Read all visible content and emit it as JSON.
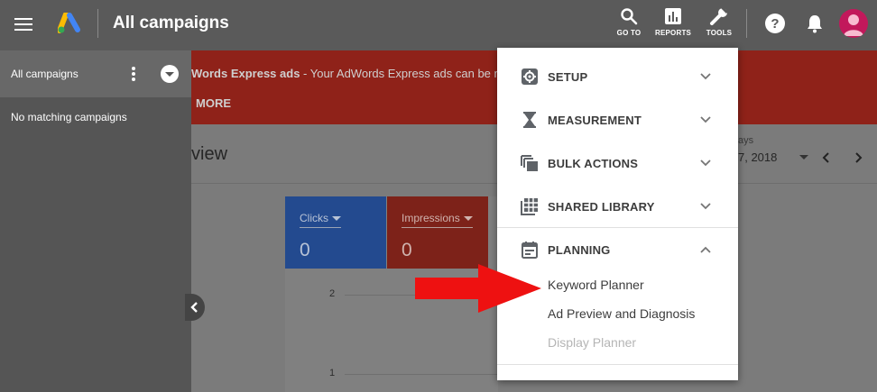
{
  "header": {
    "title": "All campaigns",
    "actions": [
      {
        "label": "GO TO",
        "icon": "search-icon"
      },
      {
        "label": "REPORTS",
        "icon": "bar-chart-icon"
      },
      {
        "label": "TOOLS",
        "icon": "wrench-icon"
      }
    ]
  },
  "sidebar": {
    "title": "All campaigns",
    "empty_text": "No matching campaigns"
  },
  "banner": {
    "text_bold": "Words Express ads",
    "text_rest": " - Your AdWords Express ads can be ma",
    "more_label": "MORE"
  },
  "main": {
    "title": "view",
    "date_caption": "ays",
    "date_value": "7, 2018"
  },
  "chart": {
    "tiles": [
      {
        "label": "Clicks",
        "value": "0"
      },
      {
        "label": "Impressions",
        "value": "0"
      }
    ],
    "y_ticks": [
      "2",
      "1"
    ]
  },
  "tools_menu": {
    "sections": [
      {
        "label": "SETUP",
        "icon": "gear-icon",
        "expanded": false
      },
      {
        "label": "MEASUREMENT",
        "icon": "hourglass-icon",
        "expanded": false
      },
      {
        "label": "BULK ACTIONS",
        "icon": "copy-icon",
        "expanded": false
      },
      {
        "label": "SHARED LIBRARY",
        "icon": "grid-icon",
        "expanded": false
      },
      {
        "label": "PLANNING",
        "icon": "calendar-icon",
        "expanded": true
      }
    ],
    "planning_items": [
      {
        "label": "Keyword Planner",
        "enabled": true
      },
      {
        "label": "Ad Preview and Diagnosis",
        "enabled": true
      },
      {
        "label": "Display Planner",
        "enabled": false
      }
    ]
  },
  "colors": {
    "annotation_arrow": "#ee1111",
    "clicks_tile": "#234a8f",
    "impressions_tile": "#7d2219",
    "avatar": "#c2185b"
  }
}
